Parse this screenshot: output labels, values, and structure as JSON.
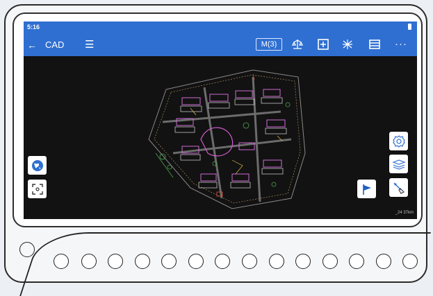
{
  "status": {
    "time": "5:16"
  },
  "appbar": {
    "back_icon": "arrow-left-icon",
    "title": "CAD",
    "menu_icon": "hamburger-icon"
  },
  "toolbar": {
    "mode_label": "M(3)",
    "icons": [
      "scale-icon",
      "zoom-fit-icon",
      "snap-icon",
      "layers-icon",
      "more-icon"
    ],
    "more_label": "···"
  },
  "right_tools": [
    "settings-icon",
    "layer-tool-icon",
    "measure-icon"
  ],
  "left_tools": [
    "globe-icon",
    "focus-icon"
  ],
  "flag_icon": "flag-icon",
  "scale_label": "_24 37km",
  "colors": {
    "appbar": "#2f6fd1",
    "canvas": "#121212",
    "accent": "#2f6fd1"
  }
}
